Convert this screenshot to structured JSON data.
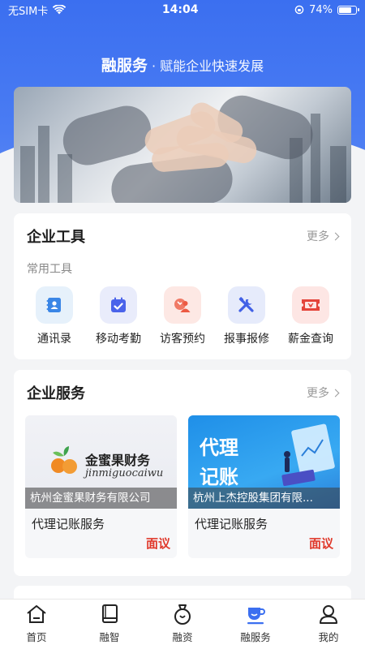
{
  "status": {
    "carrier": "无SIM卡",
    "time": "14:04",
    "battery": "74%",
    "battery_level": 0.74
  },
  "hero": {
    "title": "融服务",
    "subtitle": "· 赋能企业快速发展"
  },
  "tools_card": {
    "title": "企业工具",
    "more": "更多",
    "section_label": "常用工具",
    "items": [
      {
        "label": "通讯录",
        "icon": "contacts-icon",
        "bg": "#e6f1fb",
        "color": "#3a86e6"
      },
      {
        "label": "移动考勤",
        "icon": "calendar-check-icon",
        "bg": "#e9ecfb",
        "color": "#4a63ea"
      },
      {
        "label": "访客预约",
        "icon": "visitor-icon",
        "bg": "#fde8e4",
        "color": "#ec5a43"
      },
      {
        "label": "报事报修",
        "icon": "tools-icon",
        "bg": "#e6ebfb",
        "color": "#4160e6"
      },
      {
        "label": "薪金查询",
        "icon": "ticket-icon",
        "bg": "#fde6e4",
        "color": "#e4443a"
      }
    ]
  },
  "services_card": {
    "title": "企业服务",
    "more": "更多",
    "items": [
      {
        "logo_cn": "金蜜果财务",
        "logo_en": "jinmiguocaiwu",
        "company": "杭州金蜜果财务有限公司",
        "name": "代理记账服务",
        "price": "面议"
      },
      {
        "image_text_1": "代理",
        "image_text_2": "记账",
        "company": "杭州上杰控股集团有限...",
        "name": "代理记账服务",
        "price": "面议"
      }
    ]
  },
  "tabbar": {
    "items": [
      {
        "label": "首页",
        "icon": "home-icon"
      },
      {
        "label": "融智",
        "icon": "book-icon"
      },
      {
        "label": "融资",
        "icon": "money-bag-icon"
      },
      {
        "label": "融服务",
        "icon": "cup-icon",
        "active": true
      },
      {
        "label": "我的",
        "icon": "user-icon"
      }
    ]
  },
  "colors": {
    "brand_blue": "#3b6ff0",
    "price_red": "#e0392b"
  }
}
